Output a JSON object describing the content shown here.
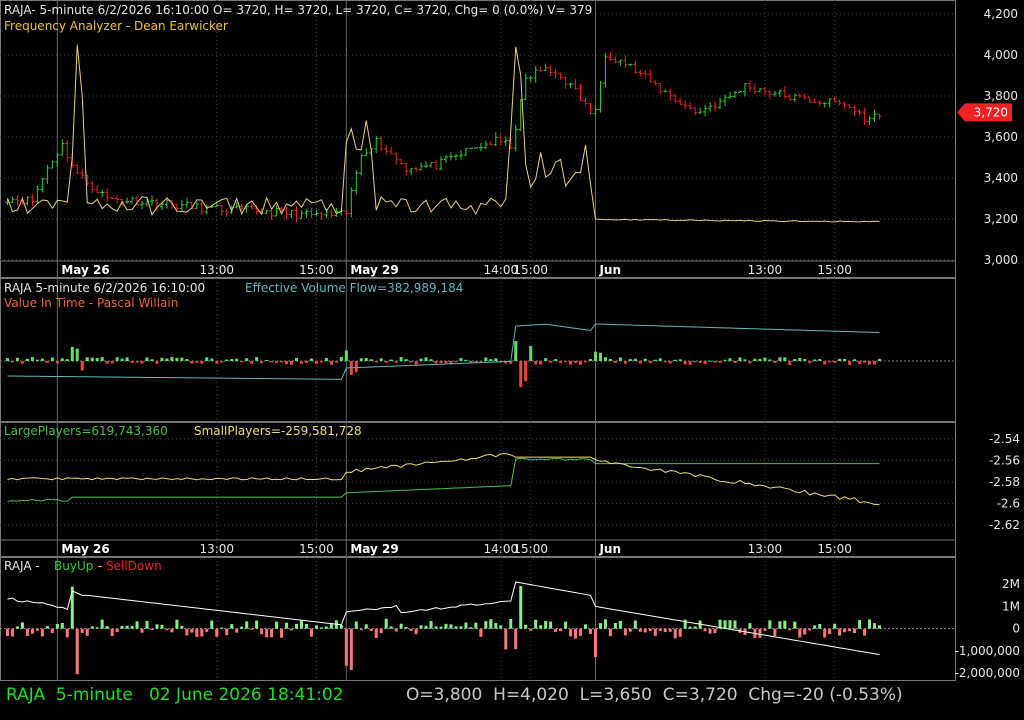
{
  "chart_data": [
    {
      "type": "candlestick",
      "panel": "price",
      "header_line1": "RAJA- 5-minute 6/2/2026 16:10:00 O= 3720, H= 3720, L= 3720, C= 3720, Chg= 0 (0.0%) V= 379",
      "header_line2": "Frequency Analyzer - Dean Earwicker",
      "ylim": [
        3000,
        4200
      ],
      "yticks": [
        "3,000",
        "3,200",
        "3,400",
        "3,600",
        "3,800",
        "4,000",
        "4,200"
      ],
      "ytick_values": [
        3000,
        3200,
        3400,
        3600,
        3800,
        4000,
        4200
      ],
      "last_price_label": "3,720",
      "last_price": 3720,
      "x_date_labels": [
        "May 26",
        "May 29",
        "Jun"
      ],
      "x_time_labels": [
        "13:00",
        "15:00",
        "13:00",
        "14:00",
        "15:00",
        "13:00",
        "15:00"
      ],
      "segments": [
        {
          "bars": 68,
          "start": 3300,
          "path": [
            [
              0,
              3300
            ],
            [
              5,
              3290
            ],
            [
              8,
              3450
            ],
            [
              11,
              3560
            ],
            [
              14,
              3420
            ],
            [
              20,
              3300
            ],
            [
              30,
              3280
            ],
            [
              40,
              3250
            ],
            [
              50,
              3240
            ],
            [
              60,
              3220
            ],
            [
              67,
              3220
            ]
          ]
        },
        {
          "bars": 34,
          "start": 3230,
          "path": [
            [
              0,
              3230
            ],
            [
              3,
              3520
            ],
            [
              6,
              3580
            ],
            [
              12,
              3450
            ],
            [
              18,
              3460
            ],
            [
              25,
              3540
            ],
            [
              30,
              3580
            ],
            [
              33,
              3560
            ]
          ]
        },
        {
          "bars": 16,
          "start": 3650,
          "path": [
            [
              0,
              3650
            ],
            [
              2,
              3880
            ],
            [
              5,
              3930
            ],
            [
              9,
              3900
            ],
            [
              12,
              3820
            ],
            [
              15,
              3720
            ]
          ]
        },
        {
          "bars": 58,
          "start": 3720,
          "path": [
            [
              0,
              3720
            ],
            [
              2,
              4010
            ],
            [
              6,
              3960
            ],
            [
              12,
              3850
            ],
            [
              20,
              3720
            ],
            [
              26,
              3780
            ],
            [
              30,
              3850
            ],
            [
              40,
              3790
            ],
            [
              50,
              3760
            ],
            [
              55,
              3680
            ],
            [
              57,
              3720
            ]
          ]
        }
      ],
      "overlay": "Frequency Analyzer",
      "overlay_color": "#e8d080"
    },
    {
      "type": "bar+line",
      "panel": "volume",
      "header_line1": "RAJA 5-minute  6/2/2026 16:10:00",
      "header_value": "Effective Volume Flow=382,989,184",
      "header_line2": "Value In Time - Pascal Willain",
      "colors": {
        "up": "#66dd66",
        "down": "#ee4444",
        "line": "#5fb8b8"
      }
    },
    {
      "type": "line",
      "panel": "players",
      "series": [
        {
          "name": "LargePlayers=619,743,360",
          "color": "#4cc04c"
        },
        {
          "name": "SmallPlayers=-259,581,728",
          "color": "#e8e070"
        }
      ],
      "ylim": [
        -2.63,
        -2.53
      ],
      "yticks": [
        "-2.54",
        "-2.56",
        "-2.58",
        "-2.6",
        "-2.62"
      ],
      "ytick_values": [
        -2.54,
        -2.56,
        -2.58,
        -2.6,
        -2.62
      ],
      "x_date_labels": [
        "May 26",
        "May 29",
        "Jun"
      ],
      "x_time_labels": [
        "13:00",
        "15:00",
        "14:00",
        "15:00",
        "13:00",
        "15:00"
      ]
    },
    {
      "type": "bar+line",
      "panel": "buyup",
      "title_prefix": "RAJA - ",
      "title_up": "BuyUp",
      "title_sep": "-",
      "title_down": "SellDown",
      "ylim": [
        -2400000,
        3000000
      ],
      "yticks": [
        "2M",
        "1M",
        "0",
        "-1,000,000",
        "-2,000,000"
      ],
      "ytick_values": [
        2000000,
        1000000,
        0,
        -1000000,
        -2000000
      ],
      "colors": {
        "up": "#88ee88",
        "down": "#ff7777",
        "line": "#ffffff"
      }
    }
  ],
  "status": {
    "left": "RAJA  5-minute   02 June 2026 18:41:02",
    "right": "O=3,800  H=4,020  L=3,650  C=3,720  Chg=-20 (-0.53%)"
  },
  "colors": {
    "up": "#33cc33",
    "down": "#ee2222",
    "grid": "#555555",
    "text": "#e6e6e6",
    "badge": "#ee2222"
  }
}
